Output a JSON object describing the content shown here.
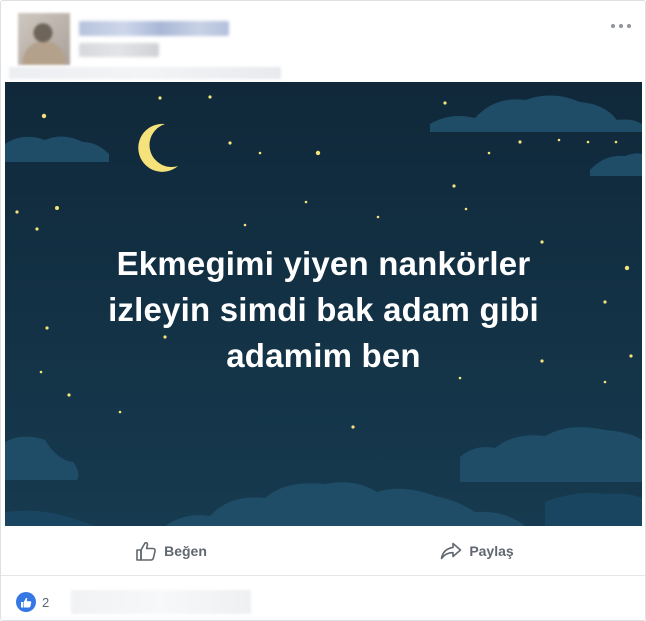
{
  "post": {
    "text_lines": [
      "Ekmegimi yiyen nankörler",
      "izleyin simdi bak adam gibi",
      "adamim ben"
    ]
  },
  "actions": {
    "like_label": "Beğen",
    "share_label": "Paylaş"
  },
  "reactions": {
    "count": "2",
    "type_icon": "like-thumb-icon"
  },
  "colors": {
    "sky": "#12303f",
    "cloud": "#1f4c66",
    "moon": "#f6e27a",
    "like_blue": "#3578e5",
    "action_gray": "#606770"
  }
}
